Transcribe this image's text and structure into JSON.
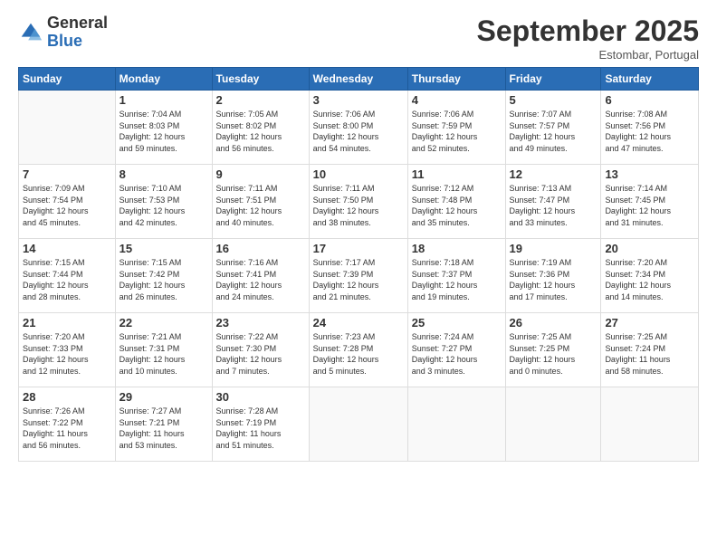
{
  "header": {
    "logo_general": "General",
    "logo_blue": "Blue",
    "month_title": "September 2025",
    "location": "Estombar, Portugal"
  },
  "days_of_week": [
    "Sunday",
    "Monday",
    "Tuesday",
    "Wednesday",
    "Thursday",
    "Friday",
    "Saturday"
  ],
  "weeks": [
    [
      {
        "day": "",
        "info": ""
      },
      {
        "day": "1",
        "info": "Sunrise: 7:04 AM\nSunset: 8:03 PM\nDaylight: 12 hours\nand 59 minutes."
      },
      {
        "day": "2",
        "info": "Sunrise: 7:05 AM\nSunset: 8:02 PM\nDaylight: 12 hours\nand 56 minutes."
      },
      {
        "day": "3",
        "info": "Sunrise: 7:06 AM\nSunset: 8:00 PM\nDaylight: 12 hours\nand 54 minutes."
      },
      {
        "day": "4",
        "info": "Sunrise: 7:06 AM\nSunset: 7:59 PM\nDaylight: 12 hours\nand 52 minutes."
      },
      {
        "day": "5",
        "info": "Sunrise: 7:07 AM\nSunset: 7:57 PM\nDaylight: 12 hours\nand 49 minutes."
      },
      {
        "day": "6",
        "info": "Sunrise: 7:08 AM\nSunset: 7:56 PM\nDaylight: 12 hours\nand 47 minutes."
      }
    ],
    [
      {
        "day": "7",
        "info": "Sunrise: 7:09 AM\nSunset: 7:54 PM\nDaylight: 12 hours\nand 45 minutes."
      },
      {
        "day": "8",
        "info": "Sunrise: 7:10 AM\nSunset: 7:53 PM\nDaylight: 12 hours\nand 42 minutes."
      },
      {
        "day": "9",
        "info": "Sunrise: 7:11 AM\nSunset: 7:51 PM\nDaylight: 12 hours\nand 40 minutes."
      },
      {
        "day": "10",
        "info": "Sunrise: 7:11 AM\nSunset: 7:50 PM\nDaylight: 12 hours\nand 38 minutes."
      },
      {
        "day": "11",
        "info": "Sunrise: 7:12 AM\nSunset: 7:48 PM\nDaylight: 12 hours\nand 35 minutes."
      },
      {
        "day": "12",
        "info": "Sunrise: 7:13 AM\nSunset: 7:47 PM\nDaylight: 12 hours\nand 33 minutes."
      },
      {
        "day": "13",
        "info": "Sunrise: 7:14 AM\nSunset: 7:45 PM\nDaylight: 12 hours\nand 31 minutes."
      }
    ],
    [
      {
        "day": "14",
        "info": "Sunrise: 7:15 AM\nSunset: 7:44 PM\nDaylight: 12 hours\nand 28 minutes."
      },
      {
        "day": "15",
        "info": "Sunrise: 7:15 AM\nSunset: 7:42 PM\nDaylight: 12 hours\nand 26 minutes."
      },
      {
        "day": "16",
        "info": "Sunrise: 7:16 AM\nSunset: 7:41 PM\nDaylight: 12 hours\nand 24 minutes."
      },
      {
        "day": "17",
        "info": "Sunrise: 7:17 AM\nSunset: 7:39 PM\nDaylight: 12 hours\nand 21 minutes."
      },
      {
        "day": "18",
        "info": "Sunrise: 7:18 AM\nSunset: 7:37 PM\nDaylight: 12 hours\nand 19 minutes."
      },
      {
        "day": "19",
        "info": "Sunrise: 7:19 AM\nSunset: 7:36 PM\nDaylight: 12 hours\nand 17 minutes."
      },
      {
        "day": "20",
        "info": "Sunrise: 7:20 AM\nSunset: 7:34 PM\nDaylight: 12 hours\nand 14 minutes."
      }
    ],
    [
      {
        "day": "21",
        "info": "Sunrise: 7:20 AM\nSunset: 7:33 PM\nDaylight: 12 hours\nand 12 minutes."
      },
      {
        "day": "22",
        "info": "Sunrise: 7:21 AM\nSunset: 7:31 PM\nDaylight: 12 hours\nand 10 minutes."
      },
      {
        "day": "23",
        "info": "Sunrise: 7:22 AM\nSunset: 7:30 PM\nDaylight: 12 hours\nand 7 minutes."
      },
      {
        "day": "24",
        "info": "Sunrise: 7:23 AM\nSunset: 7:28 PM\nDaylight: 12 hours\nand 5 minutes."
      },
      {
        "day": "25",
        "info": "Sunrise: 7:24 AM\nSunset: 7:27 PM\nDaylight: 12 hours\nand 3 minutes."
      },
      {
        "day": "26",
        "info": "Sunrise: 7:25 AM\nSunset: 7:25 PM\nDaylight: 12 hours\nand 0 minutes."
      },
      {
        "day": "27",
        "info": "Sunrise: 7:25 AM\nSunset: 7:24 PM\nDaylight: 11 hours\nand 58 minutes."
      }
    ],
    [
      {
        "day": "28",
        "info": "Sunrise: 7:26 AM\nSunset: 7:22 PM\nDaylight: 11 hours\nand 56 minutes."
      },
      {
        "day": "29",
        "info": "Sunrise: 7:27 AM\nSunset: 7:21 PM\nDaylight: 11 hours\nand 53 minutes."
      },
      {
        "day": "30",
        "info": "Sunrise: 7:28 AM\nSunset: 7:19 PM\nDaylight: 11 hours\nand 51 minutes."
      },
      {
        "day": "",
        "info": ""
      },
      {
        "day": "",
        "info": ""
      },
      {
        "day": "",
        "info": ""
      },
      {
        "day": "",
        "info": ""
      }
    ]
  ]
}
